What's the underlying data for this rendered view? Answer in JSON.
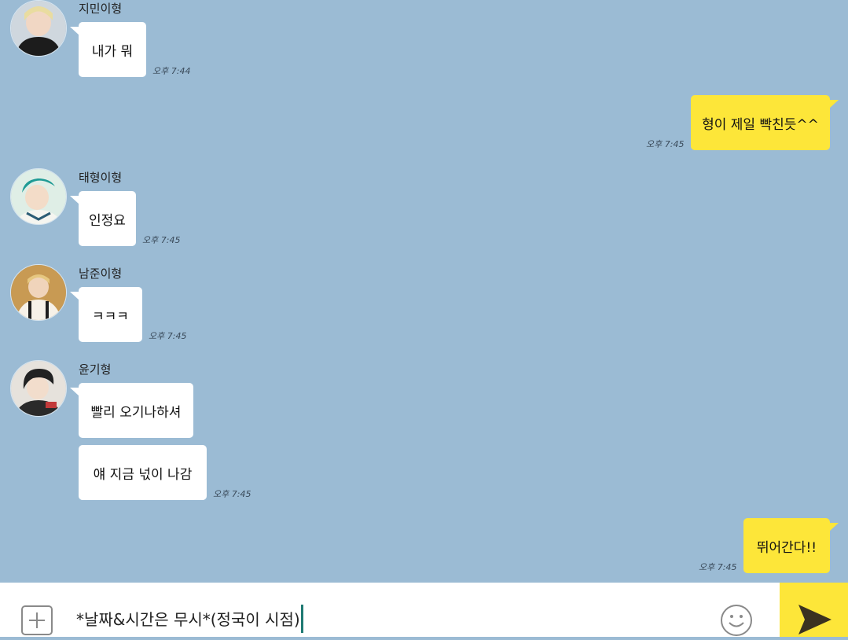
{
  "colors": {
    "background": "#9bbbd4",
    "my_bubble": "#fde639",
    "their_bubble": "#ffffff",
    "send_button": "#fde639"
  },
  "messages": [
    {
      "sender": "지민이형",
      "text": "내가 뭐",
      "time": "오후 7:44"
    },
    {
      "sender": "me",
      "text": "형이 제일 빡친듯^^",
      "time": "오후 7:45"
    },
    {
      "sender": "태형이형",
      "text": "인정요",
      "time": "오후 7:45"
    },
    {
      "sender": "남준이형",
      "text": "ㅋㅋㅋ",
      "time": "오후 7:45"
    },
    {
      "sender": "윤기형",
      "text": "빨리 오기나하셔",
      "time": ""
    },
    {
      "sender": "윤기형",
      "text": "얘 지금 넋이 나감",
      "time": "오후 7:45"
    },
    {
      "sender": "me",
      "text": "뛰어간다!!",
      "time": "오후 7:45"
    }
  ],
  "input": {
    "value": "*날짜&시간은 무시*(정국이 시점)",
    "plus_icon": "plus-icon",
    "emoji_icon": "smiley-icon",
    "send_icon": "send-arrow-icon"
  }
}
